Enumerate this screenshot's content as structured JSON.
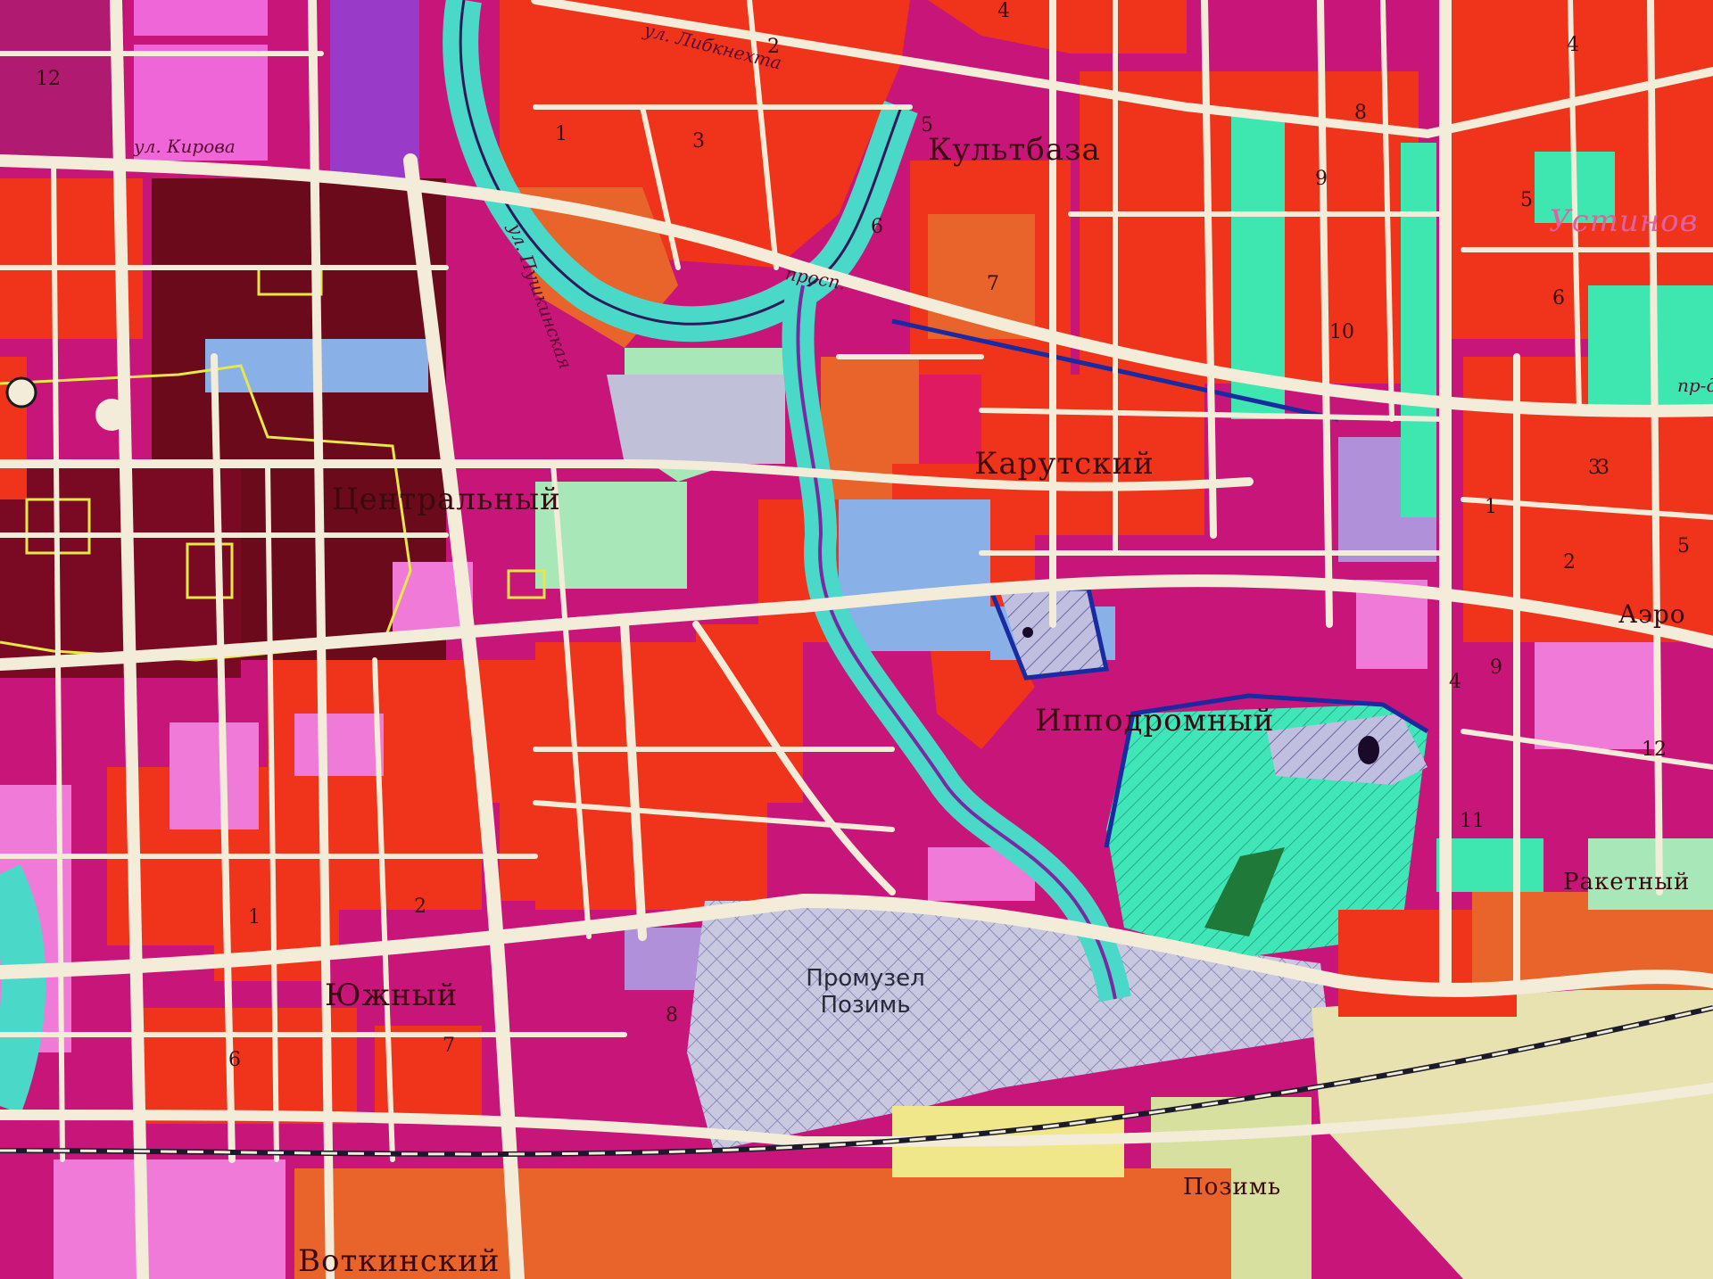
{
  "districts": {
    "kultbaza": "Культбаза",
    "tsentralny": "Центральный",
    "karutsky": "Карутский",
    "ippodromny": "Ипподромный",
    "yuzhny": "Южный",
    "raketny": "Ракетный",
    "votkinsky": "Воткинский",
    "pozim": "Позимь",
    "ustinovsky_partial": "Устинов",
    "aero_partial": "Аэро"
  },
  "industrial_zone": {
    "line1": "Промузел",
    "line2": "Позимь"
  },
  "streets": {
    "kirova": "ул. Кирова",
    "libknekhta": "ул. Либкнехта",
    "pushkinskaya": "ул. Пушкинская",
    "proezd": "просп.",
    "molod": "пр-д"
  },
  "block_numbers": [
    "12",
    "2",
    "4",
    "4",
    "1",
    "3",
    "5",
    "8",
    "9",
    "6",
    "7",
    "5",
    "10",
    "6",
    "3",
    "1",
    "2",
    "5",
    "9",
    "4",
    "12",
    "11",
    "1",
    "2",
    "6",
    "7",
    "8",
    "3"
  ],
  "colors": {
    "residential_high": "#f0341c",
    "residential_mid": "#c8157a",
    "public": "#8a0a20",
    "commercial": "#f07ad8",
    "green": "#3ee6b0",
    "industrial": "#b8b8d8",
    "orange": "#e8642a",
    "roads": "#f2ecd8",
    "water": "#4ad8c8",
    "rural": "#e8e2b0"
  }
}
